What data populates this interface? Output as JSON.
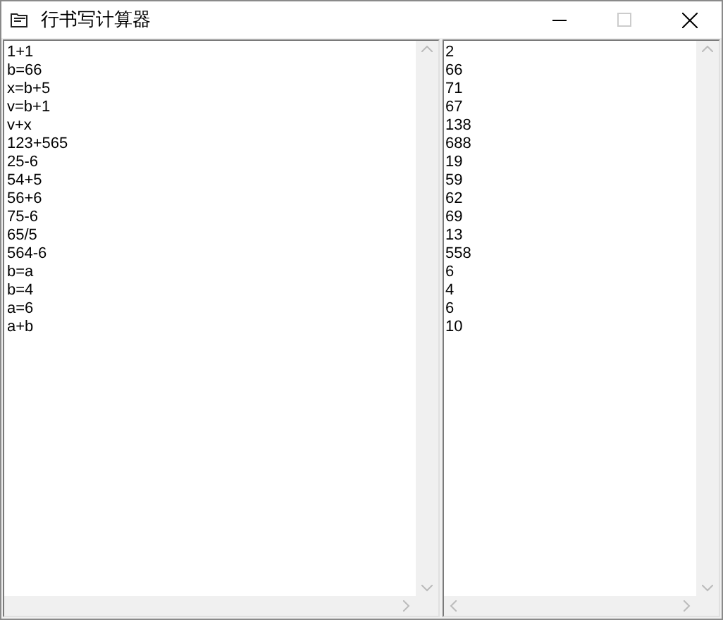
{
  "window": {
    "title": "行书写计算器"
  },
  "expressions": [
    "1+1",
    "b=66",
    "x=b+5",
    "v=b+1",
    "v+x",
    "123+565",
    "25-6",
    "54+5",
    "56+6",
    "75-6",
    "65/5",
    "564-6",
    "b=a",
    "b=4",
    "a=6",
    "a+b"
  ],
  "results": [
    "2",
    "66",
    "71",
    "67",
    "138",
    "688",
    "19",
    "59",
    "62",
    "69",
    "13",
    "558",
    "6",
    "4",
    "6",
    "10"
  ]
}
